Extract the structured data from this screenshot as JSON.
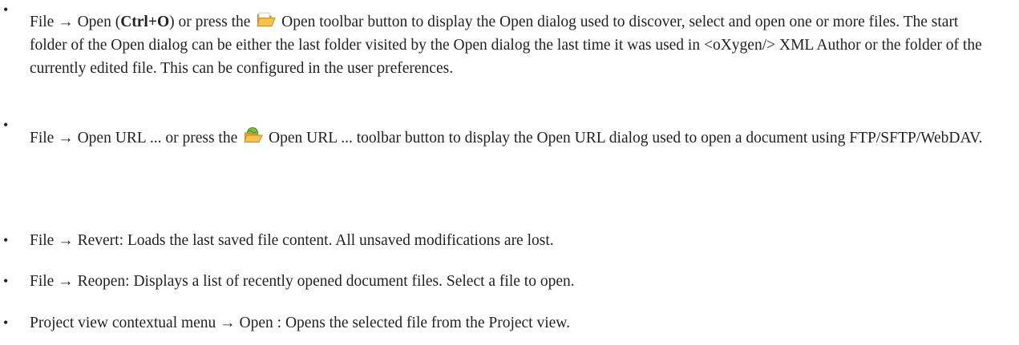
{
  "items": [
    {
      "part1": "File → Open (",
      "shortcut": "Ctrl+O",
      "part2": ") or press the ",
      "icon": "open-folder-icon",
      "part3": " Open toolbar button to display the Open dialog used to discover, select and open one or more files. The start folder of the Open dialog can be either the last folder visited by the Open dialog the last time it was used in <oXygen/> XML Author or the folder of the currently edited file. This can be configured in the user preferences."
    },
    {
      "part1": "File → Open URL ... or press the ",
      "icon": "open-url-icon",
      "part2": " Open URL ... toolbar button to display the Open URL dialog used to open a document using FTP/SFTP/WebDAV."
    },
    {
      "text": "File → Revert: Loads the last saved file content. All unsaved modifications are lost."
    },
    {
      "text": "File → Reopen: Displays a list of recently opened document files. Select a file to open."
    },
    {
      "text": "Project view contextual menu → Open : Opens the selected file from the Project view."
    }
  ],
  "colors": {
    "text": "#222222",
    "folder_fill": "#f6c24a",
    "folder_edge": "#c98a1c",
    "globe_fill": "#7cc242"
  }
}
